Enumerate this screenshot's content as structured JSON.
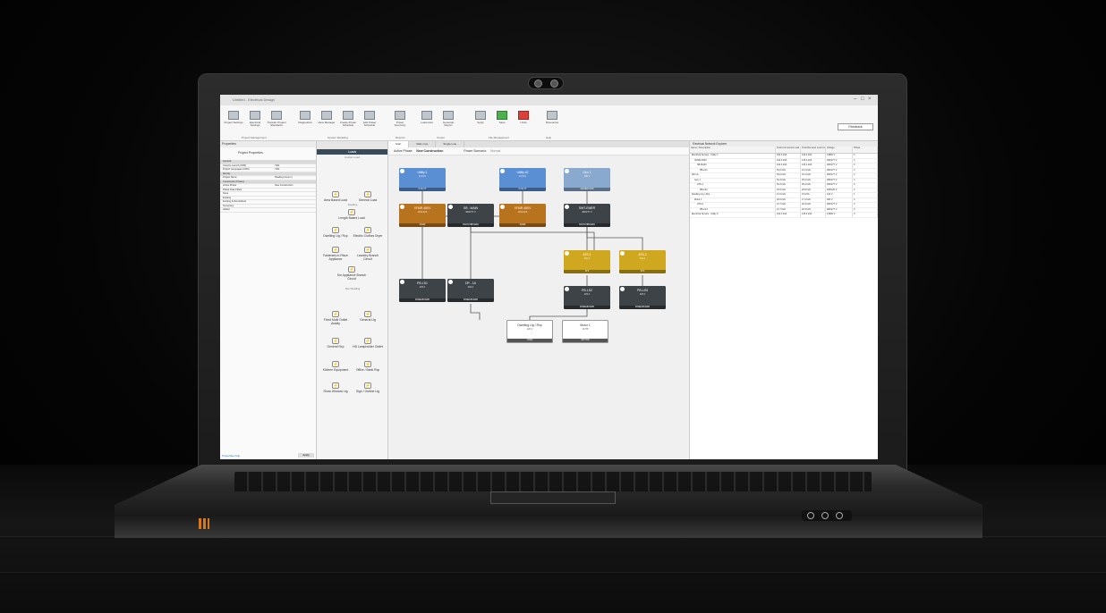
{
  "app": {
    "title": "Untitled - Electrical Design",
    "window_controls": [
      "–",
      "□",
      "×"
    ],
    "feedback_label": "Feedback"
  },
  "ribbon": {
    "buttons": [
      {
        "label": "Project Settings"
      },
      {
        "label": "Electrical Settings"
      },
      {
        "label": "Transfer Project Standards"
      },
      {
        "label": "Diagnostics"
      },
      {
        "label": "View Manager"
      },
      {
        "label": "Create Power Schedule"
      },
      {
        "label": "Add Power Schedule"
      },
      {
        "label": "Power Summary"
      },
      {
        "label": "Load Lists"
      },
      {
        "label": "Generate Report"
      },
      {
        "label": "Apply"
      },
      {
        "label": "Save"
      },
      {
        "label": "Undo"
      },
      {
        "label": "Resources"
      }
    ],
    "groups": [
      "Project Management",
      "System Modeling",
      "Reports",
      "Output",
      "File Management",
      "Help"
    ]
  },
  "properties": {
    "title": "Properties",
    "header": "Project Properties",
    "rows": [
      {
        "k": "General",
        "v": "",
        "sec": true
      },
      {
        "k": "Country Launch (CRS)",
        "v": "YES"
      },
      {
        "k": "Project Languages (CRS)",
        "v": "YES"
      },
      {
        "k": "Identity",
        "v": "",
        "sec": true
      },
      {
        "k": "Project Name",
        "v": "Reading Green 1"
      },
      {
        "k": "Construction Phases",
        "v": "",
        "sec": true
      },
      {
        "k": "Active Phase",
        "v": "New Construction"
      },
      {
        "k": "Phase Note Filters",
        "v": ""
      },
      {
        "k": "None",
        "v": ""
      },
      {
        "k": "Existing",
        "v": ""
      },
      {
        "k": "Existing & Demolished",
        "v": ""
      },
      {
        "k": "Temporary",
        "v": ""
      },
      {
        "k": "Added",
        "v": ""
      }
    ],
    "footer_link": "Properties help",
    "apply": "Apply"
  },
  "loads": {
    "caption": "Loads",
    "category_custom": "Custom Load",
    "category_dwelling": "Dwelling",
    "category_nondwelling": "Non Dwelling",
    "items": [
      "Area Based Load",
      "General Load",
      "Length Based Load",
      "Dwelling Ltg / Rcp",
      "Electric Clothes Dryer",
      "Fastened-In-Place Appliance",
      "Laundry Branch Circuit",
      "Sm Appliance Branch Circuit",
      "Fixed Multi Outlet Assbly",
      "General Ltg",
      "General Rcp",
      "HD Lampholder Outlet",
      "Kitchen Equipment",
      "Office / Bank Rcp",
      "Show Window Ltg",
      "Sign / Outline Ltg"
    ]
  },
  "canvas": {
    "tabs": [
      "Start",
      "Main Line",
      "Single Line"
    ],
    "active_phase_label": "Active Phase:",
    "active_phase_value": "New Construction",
    "power_scenario_label": "Power Scenario:",
    "power_scenario_value": "Normal",
    "nodes": [
      {
        "id": "u1",
        "title": "Utility 1",
        "sub": "13.8 kV",
        "foot": "UTILITY",
        "color": "#5b8fd3"
      },
      {
        "id": "u2",
        "title": "Utility #2",
        "sub": "13.8 kV",
        "foot": "UTILITY",
        "color": "#5b8fd3"
      },
      {
        "id": "g1",
        "title": "Gen 1",
        "sub": "480 V",
        "foot": "GENERATOR",
        "color": "#8aa9cf"
      },
      {
        "id": "x1",
        "title": "XFMR-480V",
        "sub": "1000 kVA",
        "foot": "XFMR",
        "color": "#b8731e"
      },
      {
        "id": "s1",
        "title": "SB - MAIN",
        "sub": "480/277 V",
        "foot": "SWITCHBOARD",
        "color": "#3e4348"
      },
      {
        "id": "x2",
        "title": "XFMR-480V",
        "sub": "1000 kVA",
        "foot": "XFMR",
        "color": "#b8731e"
      },
      {
        "id": "s2",
        "title": "SWT-EMER",
        "sub": "480/277 V",
        "foot": "SWITCHBOARD",
        "color": "#3e4348"
      },
      {
        "id": "a1",
        "title": "ATS-1",
        "sub": "400 A",
        "foot": "ATS",
        "color": "#cfa820"
      },
      {
        "id": "a2",
        "title": "ATS-2",
        "sub": "400 A",
        "foot": "ATS",
        "color": "#cfa820"
      },
      {
        "id": "p1",
        "title": "PB-LS1",
        "sub": "225 A",
        "foot": "PANELBOARD",
        "color": "#3e4348"
      },
      {
        "id": "p2",
        "title": "DP - 1A",
        "sub": "400 A",
        "foot": "PANELBOARD",
        "color": "#3e4348"
      },
      {
        "id": "p3",
        "title": "PB-LS2",
        "sub": "225 A",
        "foot": "PANELBOARD",
        "color": "#3e4348"
      },
      {
        "id": "p4",
        "title": "PB-LS3",
        "sub": "225 A",
        "foot": "PANELBOARD",
        "color": "#3e4348"
      },
      {
        "id": "l1",
        "title": "Dwelling Ltg / Rcp",
        "sub": "120 V",
        "foot": "LOAD",
        "color": "#ffffff"
      },
      {
        "id": "l2",
        "title": "Motor 1",
        "sub": "10 HP",
        "foot": "MOTOR",
        "color": "#ffffff"
      }
    ]
  },
  "explorer": {
    "title": "Electrical Network Explorer",
    "columns": [
      "Name / Description",
      "Total Connected Load (VA)",
      "Total Demand Load (VA)",
      "Voltage",
      "Phase"
    ],
    "rows": [
      [
        "Electrical Service - Utility 1",
        "162.3 kVA",
        "133.4 kVA",
        "13800 V",
        "3"
      ],
      [
        "XFMR-480V",
        "162.3 kVA",
        "133.4 kVA",
        "480/277 V",
        "3"
      ],
      [
        "SB-MAIN",
        "162.3 kVA",
        "133.4 kVA",
        "480/277 V",
        "3"
      ],
      [
        "PB-LS1",
        "54.0 kVA",
        "44.1 kVA",
        "480/277 V",
        "3"
      ],
      [
        "DP-1A",
        "54.0 kVA",
        "44.1 kVA",
        "480/277 V",
        "3"
      ],
      [
        "Gen 1",
        "54.3 kVA",
        "45.2 kVA",
        "480/277 V",
        "3"
      ],
      [
        "ATS-1",
        "54.3 kVA",
        "45.2 kVA",
        "480/277 V",
        "3"
      ],
      [
        "PB-LS2",
        "32.6 kVA",
        "26.8 kVA",
        "208/120 V",
        "3"
      ],
      [
        "Dwelling Ltg / Rcp",
        "12.0 kVA",
        "9.6 kVA",
        "120 V",
        "1"
      ],
      [
        "Motor 1",
        "20.6 kVA",
        "17.2 kVA",
        "480 V",
        "3"
      ],
      [
        "ATS-2",
        "21.7 kVA",
        "18.4 kVA",
        "480/277 V",
        "3"
      ],
      [
        "PB-LS3",
        "21.7 kVA",
        "18.4 kVA",
        "480/277 V",
        "3"
      ],
      [
        "Electrical Service - Utility 2",
        "162.3 kVA",
        "133.4 kVA",
        "13800 V",
        "3"
      ]
    ]
  }
}
